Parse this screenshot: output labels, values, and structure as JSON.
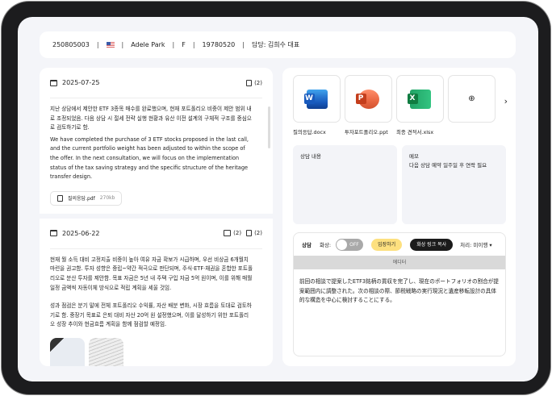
{
  "header": {
    "id": "250805003",
    "flag": "us-flag",
    "name": "Adele Park",
    "gender": "F",
    "birth": "19780520",
    "manager": "담당: 김희수 대표"
  },
  "entries": [
    {
      "date": "2025-07-25",
      "doc_count": "(2)",
      "text_ko": "지난 상담에서 제안한 ETF 3종목 매수를 완료했으며, 현재 포트폴리오 비중이 제안 범위 내로 조정되었음. 다음 상담 시 절세 전략 실행 현황과 유산 이전 설계의 구체적 구조를 중심으로 검토하기로 함.",
      "text_en": "We have completed the purchase of 3 ETF stocks proposed in the last call, and the current portfolio weight has been adjusted to within the scope of the offer. In the next consultation, we will focus on the implementation status of the tax saving strategy and the specific structure of the heritage transfer design.",
      "attachment": {
        "name": "질의응답.pdf",
        "size": "270kb"
      }
    },
    {
      "date": "2025-06-22",
      "image_count": "(2)",
      "doc_count": "(2)",
      "text_1": "현재 월 소득 대비 고정지출 비중이 높아 여유 자금 확보가 시급하며, 우선 비상금 6개월치 마련을 권고함. 투자 성향은 중립~약간 적극으로 판단되며, 주식·ETF·채권을 혼합한 포트폴리오로 분산 투자를 제안함. 목표 자금은 5년 내 주택 구입 자금 5억 원이며, 이를 위해 매월 일정 금액씩 자동이체 방식으로 적립 계획을 세울 것임.",
      "text_2": "성과 점검은 분기 말에 전체 포트폴리오 수익률, 자산 배분 변화, 시장 흐름을 토대로 검토하기로 함. 중장기 목표로 은퇴 대비 자산 20억 원 설정했으며, 이를 달성하기 위한 포트폴리오 성장 추이와 현금흐름 계획을 함께 점검할 예정임."
    }
  ],
  "files": [
    {
      "name": "질의응답.docx",
      "type": "word",
      "color": "#185abd"
    },
    {
      "name": "투자포트폴리오.ppt",
      "type": "powerpoint",
      "color": "#c43e1c"
    },
    {
      "name": "최종 견적서.xlsx",
      "type": "excel",
      "color": "#107c41"
    }
  ],
  "boxes": {
    "content_label": "상담 내용",
    "memo_label": "메모",
    "memo_text": "다음 상담 예약 일주일 후 연락 필요"
  },
  "toolbar": {
    "consult": "상담",
    "video_label": "화상:",
    "toggle": "OFF",
    "enter": "입장하기",
    "copy_link": "화상 링크 복사",
    "status": "처리: 미이행"
  },
  "editor": {
    "label": "에디터",
    "text": "前回の相談で提案したETF3銘柄の買収を完了し、現在のポートフォリオの割合が提案範囲内に調整された。次の相談の際、節税戦略の実行現況と遺産移転設計の具体的な構造を中心に検討することにする。"
  }
}
